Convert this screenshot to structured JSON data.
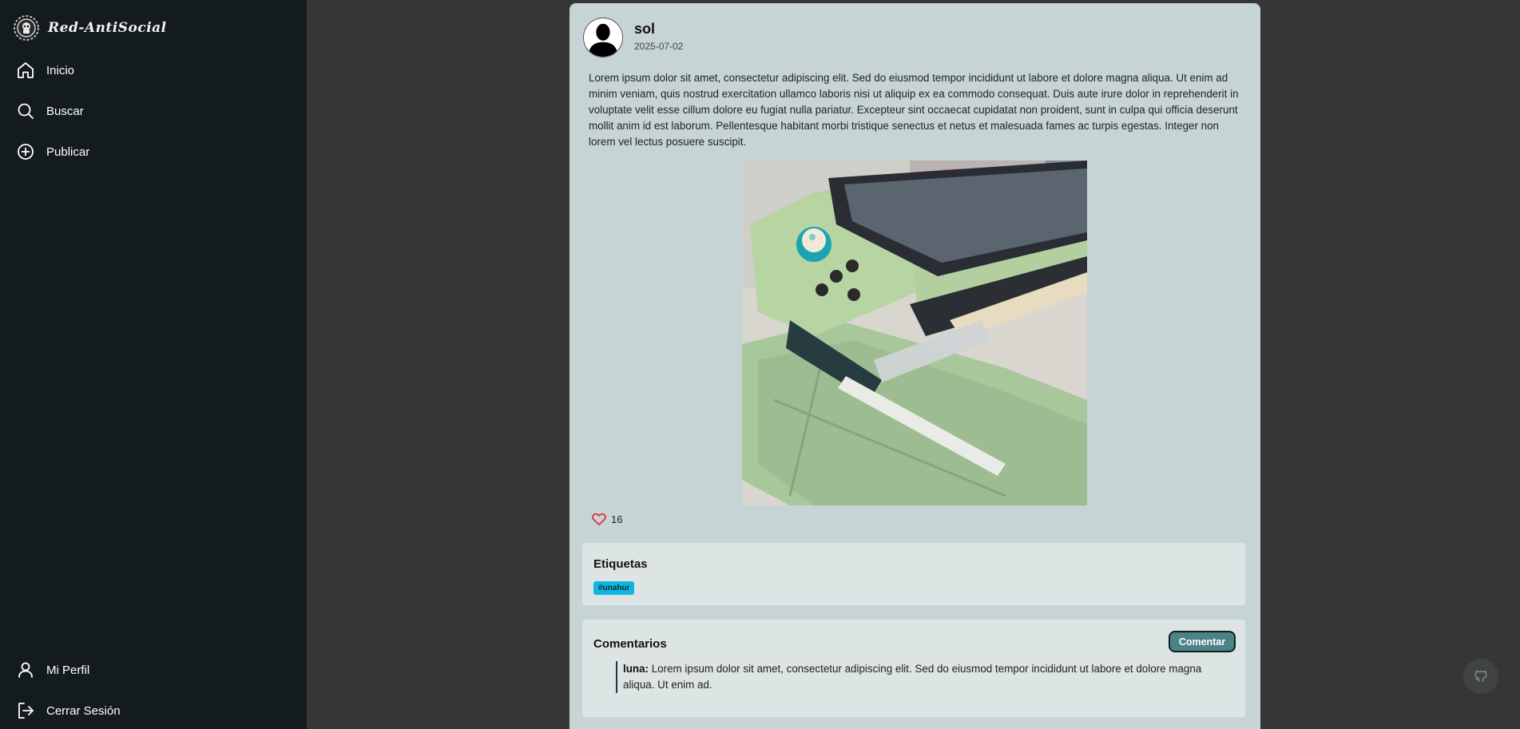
{
  "sidebar": {
    "brand_name": "Red-AntiSocial",
    "nav": [
      {
        "label": "Inicio",
        "icon": "home-icon"
      },
      {
        "label": "Buscar",
        "icon": "search-icon"
      },
      {
        "label": "Publicar",
        "icon": "plus-circle-icon"
      }
    ],
    "bottom_nav": [
      {
        "label": "Mi Perfil",
        "icon": "user-icon"
      },
      {
        "label": "Cerrar Sesión",
        "icon": "logout-icon"
      }
    ]
  },
  "post": {
    "author": "sol",
    "date": "2025-07-02",
    "text": "Lorem ipsum dolor sit amet, consectetur adipiscing elit. Sed do eiusmod tempor incididunt ut labore et dolore magna aliqua. Ut enim ad minim veniam, quis nostrud exercitation ullamco laboris nisi ut aliquip ex ea commodo consequat. Duis aute irure dolor in reprehenderit in voluptate velit esse cillum dolore eu fugiat nulla pariatur. Excepteur sint occaecat cupidatat non proident, sunt in culpa qui officia deserunt mollit anim id est laborum. Pellentesque habitant morbi tristique senectus et netus et malesuada fames ac turpis egestas. Integer non lorem vel lectus posuere suscipit.",
    "likes": "16",
    "tags_title": "Etiquetas",
    "tags": [
      "#unahur"
    ],
    "comments_title": "Comentarios",
    "comment_button": "Comentar",
    "comments": [
      {
        "user": "luna:",
        "text": "Lorem ipsum dolor sit amet, consectetur adipiscing elit. Sed do eiusmod tempor incididunt ut labore et dolore magna aliqua. Ut enim ad."
      }
    ]
  },
  "colors": {
    "sidebar_bg": "#131b1e",
    "page_bg": "#363636",
    "card_bg": "#c7d4d5",
    "panel_bg": "#dce4e4",
    "tag_bg": "#0fb7e0",
    "button_bg": "#4c8386",
    "like_color": "#d9262c"
  }
}
